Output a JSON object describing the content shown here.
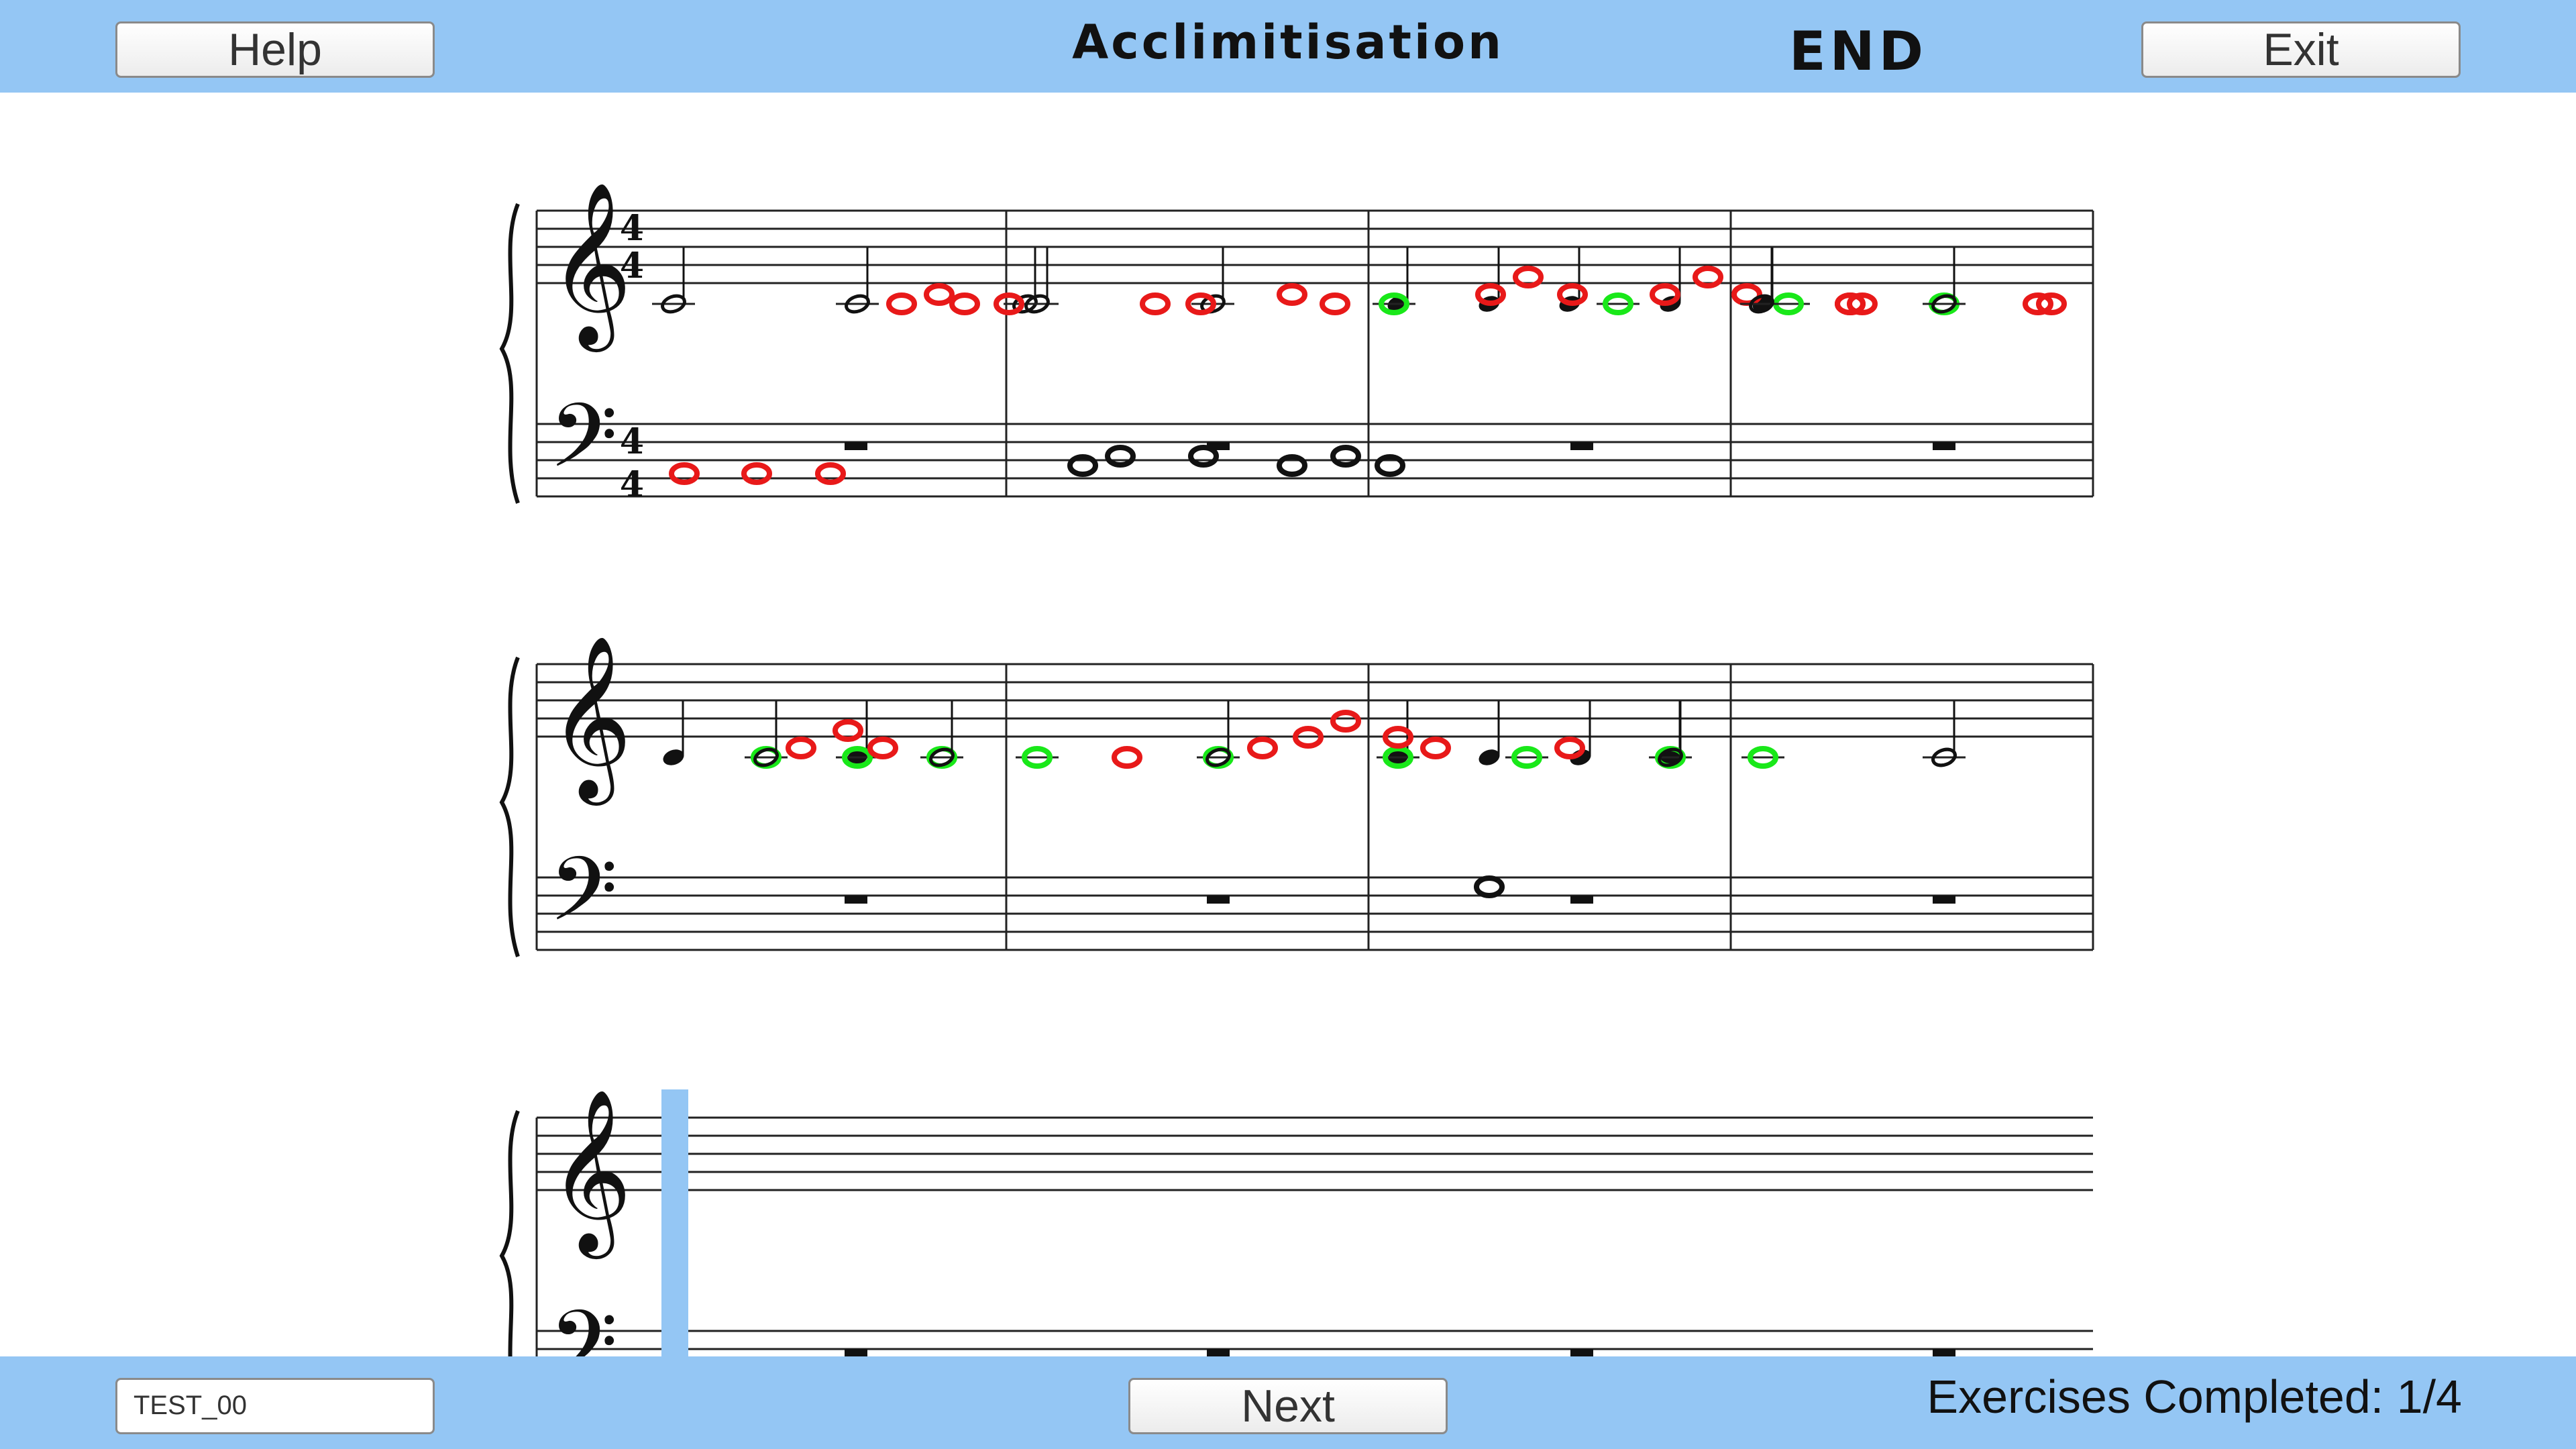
{
  "header": {
    "help_label": "Help",
    "title": "Acclimitisation",
    "end_label": "END",
    "exit_label": "Exit"
  },
  "footer": {
    "test_name": "TEST_00",
    "next_label": "Next",
    "progress_text": "Exercises Completed: 1/4"
  },
  "score": {
    "time_signature": {
      "top": "4",
      "bottom": "4"
    },
    "systems": 3,
    "measures_per_system": 4,
    "colors": {
      "correct": "#19e819",
      "wrong": "#e81919",
      "expected": "#111111",
      "cursor": "#94c6f4"
    }
  },
  "colors": {
    "bar": "#94c6f4",
    "background": "#ffffff"
  }
}
